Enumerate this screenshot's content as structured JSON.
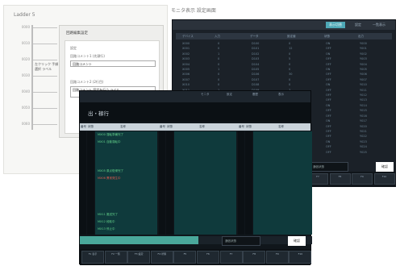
{
  "back_panel": {
    "title": "Ladder 5",
    "ladder_rows": [
      "0000",
      "0010",
      "0020",
      "0030",
      "0040",
      "0050",
      "0060"
    ],
    "ladder_note": "左クリック 手順 選択 ラベル",
    "dialog": {
      "title": "回路編集設定",
      "group_label": "設定",
      "field1_label": "回路コメント1 (先頭行)",
      "field1_value": "回路コメント",
      "field2_label": "回路コメント2 (2行目)",
      "field2_value": "回路コメント 設定を行う ラベル"
    }
  },
  "top_caption": "モニタ表示 設定画面",
  "right_window": {
    "tabs": [
      "表示切替",
      "設定",
      "一覧表示"
    ],
    "active_tab_index": 0,
    "header_cells": [
      "デバイス",
      "入力",
      "データ",
      "設定値",
      "状態",
      "出力"
    ],
    "columns": [
      [
        "X000",
        "X001",
        "X002",
        "X003",
        "X004",
        "X005",
        "X006",
        "X007",
        "X010",
        "X011",
        "X012",
        "X013",
        "X014",
        "X015",
        "X016",
        "X017",
        "X020",
        "X021",
        "X022",
        "X023",
        "X024",
        "X025"
      ],
      [
        "0",
        "0",
        "1",
        "0",
        "0",
        "1",
        "0",
        "0",
        "0",
        "1",
        "0",
        "0",
        "0",
        "0",
        "1",
        "0",
        "0",
        "0",
        "0",
        "0",
        "1",
        "0"
      ],
      [
        "D100",
        "D101",
        "D102",
        "D103",
        "D104",
        "D105",
        "D106",
        "D107",
        "D108",
        "D109",
        "D110",
        "D111",
        "D112",
        "D113",
        "D114",
        "D115",
        "D116",
        "D117",
        "D118",
        "D119",
        "D120",
        "D121"
      ],
      [
        "0",
        "12",
        "0",
        "5",
        "0",
        "0",
        "30",
        "0",
        "0",
        "7",
        "0",
        "0",
        "0",
        "3",
        "0",
        "0",
        "0",
        "0",
        "9",
        "0",
        "0",
        "0"
      ],
      [
        "ON",
        "OFF",
        "ON",
        "OFF",
        "OFF",
        "ON",
        "OFF",
        "OFF",
        "ON",
        "OFF",
        "OFF",
        "OFF",
        "ON",
        "OFF",
        "OFF",
        "ON",
        "OFF",
        "OFF",
        "OFF",
        "ON",
        "OFF",
        "OFF"
      ],
      [
        "Y000",
        "Y001",
        "Y002",
        "Y003",
        "Y004",
        "Y005",
        "Y006",
        "Y007",
        "Y010",
        "Y011",
        "Y012",
        "Y013",
        "Y014",
        "Y015",
        "Y016",
        "Y017",
        "Y020",
        "Y021",
        "Y022",
        "Y023",
        "Y024",
        "Y025"
      ]
    ],
    "status_text": "通信状態",
    "white_button": "確認",
    "fkeys": [
      "F1",
      "F2",
      "F3",
      "F4",
      "F5",
      "F6",
      "F7",
      "F8",
      "F9",
      "F10"
    ]
  },
  "front_window": {
    "tabs": [
      "モニタ",
      "設定",
      "履歴",
      "表示"
    ],
    "heading": "出・稼行",
    "column_headers": [
      "番号",
      "状態",
      "名称",
      "番号",
      "状態",
      "名称",
      "番号",
      "状態",
      "名称"
    ],
    "group1_rows": [
      {
        "text": "MX00 運転準備完了",
        "color": "green"
      },
      {
        "text": "MX01 自動運転中",
        "color": "green"
      },
      {
        "text": "",
        "color": "dim"
      },
      {
        "text": "",
        "color": "dim"
      },
      {
        "text": "",
        "color": "dim"
      },
      {
        "text": "MX05 原点復帰完了",
        "color": "green"
      },
      {
        "text": "MX06 異常発生中",
        "color": "red"
      },
      {
        "text": "",
        "color": "dim"
      },
      {
        "text": "",
        "color": "dim"
      },
      {
        "text": "",
        "color": "dim"
      },
      {
        "text": "",
        "color": "dim"
      },
      {
        "text": "MX11 搬送完了",
        "color": "green"
      },
      {
        "text": "MX12 段取中",
        "color": "green"
      },
      {
        "text": "MX13 停止中",
        "color": "green"
      }
    ],
    "status_text": "通信状態",
    "white_button": "確認",
    "progress": 0.51,
    "fkeys": [
      "F1 表示",
      "F2 一覧",
      "F3 設定",
      "F4 状態",
      "F5",
      "F6",
      "F7",
      "F8",
      "F9",
      "F10"
    ]
  }
}
